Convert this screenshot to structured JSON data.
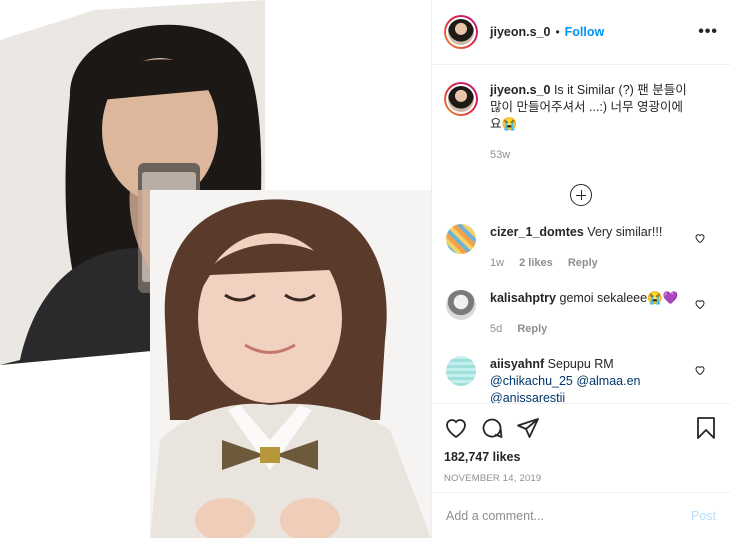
{
  "post": {
    "username": "jiyeon.s_0",
    "dot": "•",
    "follow_label": "Follow",
    "more_label": "•••"
  },
  "caption": {
    "username": "jiyeon.s_0",
    "text": "Is it Similar (?) 팬 분들이 많이 만들어주셔서 ...:) 너무 영광이에요😭",
    "time": "53w"
  },
  "comments": [
    {
      "username": "cizer_1_domtes",
      "text": "Very similar!!!",
      "time": "1w",
      "likes": "2 likes",
      "reply": "Reply"
    },
    {
      "username": "kalisahptry",
      "text": "gemoi sekaleee😭💜",
      "time": "5d",
      "reply": "Reply"
    },
    {
      "username": "aiisyahnf",
      "text": "Sepupu RM",
      "mention1": "@chikachu_25",
      "mention2": "@almaa.en",
      "mention3": "@anissarestii"
    }
  ],
  "stats": {
    "likes": "182,747 likes",
    "date": "NOVEMBER 14, 2019"
  },
  "add_comment": {
    "placeholder": "Add a comment...",
    "post_label": "Post"
  },
  "colors": {
    "accent": "#0095f6",
    "muted": "#8e8e8e",
    "post_disabled": "#b2dffc"
  },
  "icons": [
    "heart-icon",
    "comment-icon",
    "share-icon",
    "bookmark-icon",
    "more-icon",
    "plus-circle-icon"
  ]
}
